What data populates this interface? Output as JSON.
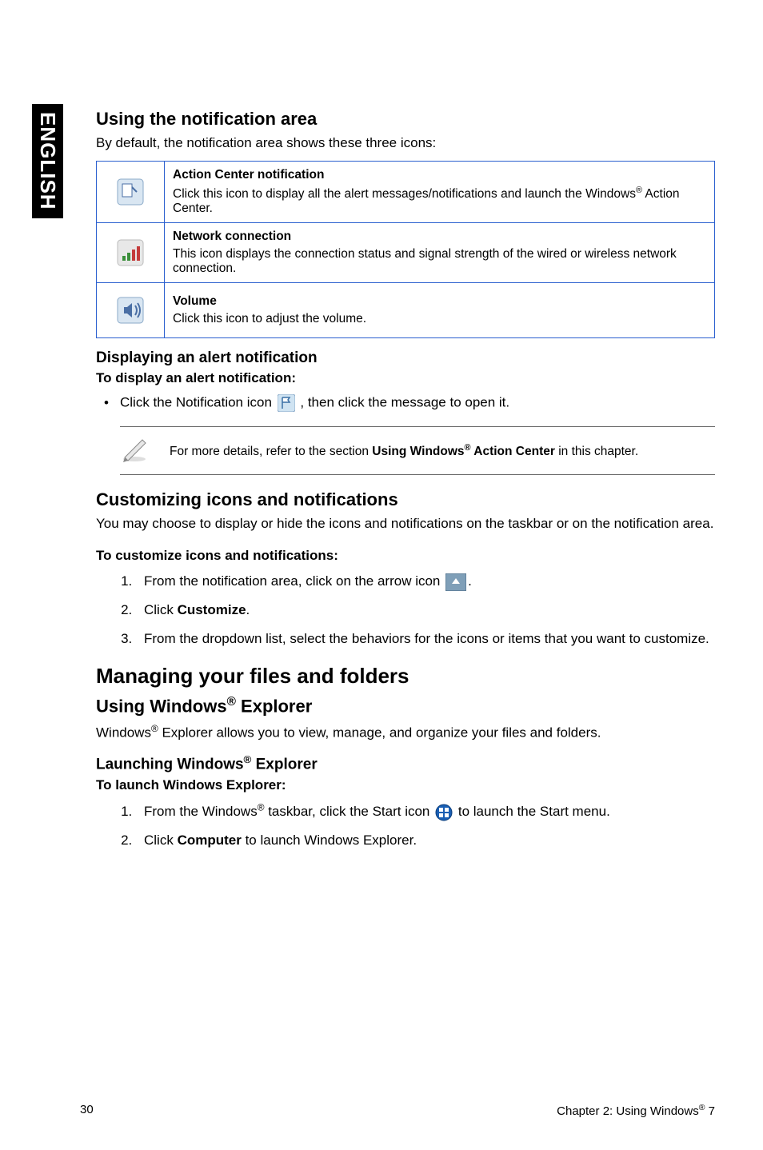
{
  "side_tab": "ENGLISH",
  "section1": {
    "heading": "Using the notification area",
    "intro": "By default, the notification area shows these three icons:",
    "rows": [
      {
        "icon": "action-center-icon",
        "title": "Action Center notification",
        "desc_pre": "Click this icon to display all the alert messages/notifications and launch the Windows",
        "desc_post": " Action Center."
      },
      {
        "icon": "network-icon",
        "title": "Network connection",
        "desc": "This icon displays the connection status and signal strength of the wired or wireless network connection."
      },
      {
        "icon": "volume-icon",
        "title": "Volume",
        "desc": "Click this icon to adjust the volume."
      }
    ],
    "alert_heading": "Displaying an alert notification",
    "alert_sub": "To display an alert notification:",
    "alert_step_pre": "Click the Notification icon ",
    "alert_step_post": ", then click the message to open it.",
    "note_pre": "For more details, refer to the section ",
    "note_strong_pre": "Using Windows",
    "note_strong_post": " Action Center",
    "note_post": " in this chapter."
  },
  "section2": {
    "heading": "Customizing icons and notifications",
    "intro": "You may choose to display or hide the icons and notifications on the taskbar or on the notification area.",
    "sub": "To customize icons and notifications:",
    "steps": [
      {
        "pre": "From the notification area, click on the arrow icon ",
        "icon": "arrow-tray-icon",
        "post": "."
      },
      {
        "text_pre": "Click ",
        "strong": "Customize",
        "text_post": "."
      },
      {
        "text": "From the dropdown list, select the behaviors for the icons or items that you want to customize."
      }
    ]
  },
  "section3": {
    "heading": "Managing your files and folders",
    "sub_heading": "Using Windows",
    "sub_heading_post": " Explorer",
    "intro_pre": "Windows",
    "intro_post": " Explorer allows you to view, manage, and organize your files and folders.",
    "launch_heading_pre": "Launching Windows",
    "launch_heading_post": " Explorer",
    "launch_sub": "To launch Windows Explorer:",
    "steps": [
      {
        "pre": "From the Windows",
        "mid": " taskbar, click the Start icon ",
        "icon": "start-orb-icon",
        "post": " to launch the Start menu."
      },
      {
        "text_pre": "Click ",
        "strong": "Computer",
        "text_post": " to launch Windows Explorer."
      }
    ]
  },
  "footer": {
    "left": "30",
    "right_pre": "Chapter 2: Using Windows",
    "right_post": " 7"
  }
}
